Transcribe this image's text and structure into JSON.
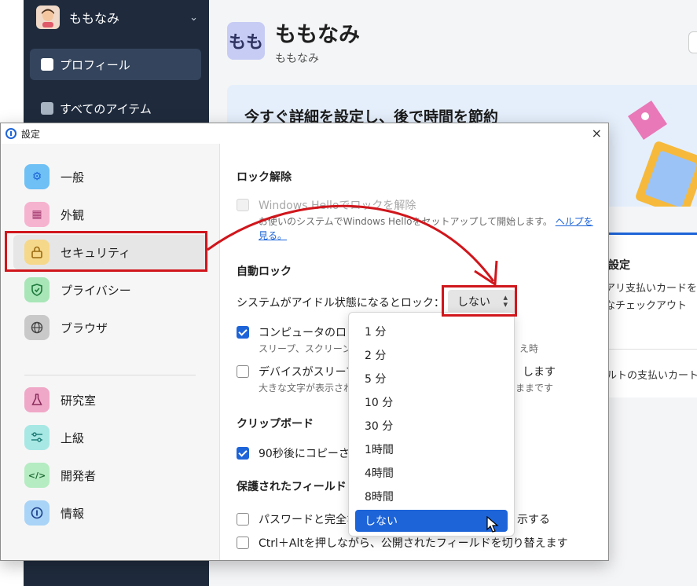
{
  "background": {
    "account_name": "ももなみ",
    "nav": [
      "プロフィール",
      "すべてのアイテム"
    ],
    "vault_icon_text": "もも",
    "vault_title": "ももなみ",
    "vault_subtitle": "ももなみ",
    "card_title": "今すぐ詳細を設定し、後で時間を節約",
    "card2_title": "設定",
    "card2_lines": [
      "アリ支払いカードを",
      "なチェックアウト",
      "。"
    ],
    "card2_footer": "ルトの支払いカート"
  },
  "dialog": {
    "title": "設定",
    "close": "×",
    "categories": [
      {
        "label": "一般",
        "icon": "gear-icon",
        "color": "#6ec0f5",
        "glyph": "⚙",
        "selected": false
      },
      {
        "label": "外観",
        "icon": "palette-icon",
        "color": "#f6b3d0",
        "glyph": "▦",
        "selected": false
      },
      {
        "label": "セキュリティ",
        "icon": "lock-icon",
        "color": "#f6d88a",
        "glyph": "🔒",
        "selected": true
      },
      {
        "label": "プライバシー",
        "icon": "shield-icon",
        "color": "#a8e6b8",
        "glyph": "✓",
        "selected": false
      },
      {
        "label": "ブラウザ",
        "icon": "globe-icon",
        "color": "#c9c9c9",
        "glyph": "◍",
        "selected": false
      },
      {
        "label": "研究室",
        "icon": "flask-icon",
        "color": "#f0a8c8",
        "glyph": "⚗",
        "selected": false
      },
      {
        "label": "上級",
        "icon": "sliders-icon",
        "color": "#a8e8e4",
        "glyph": "≡",
        "selected": false
      },
      {
        "label": "開発者",
        "icon": "code-icon",
        "color": "#b6ecc2",
        "glyph": "</>",
        "selected": false
      },
      {
        "label": "情報",
        "icon": "info-icon",
        "color": "#a9d4f7",
        "glyph": "ⓘ",
        "selected": false
      }
    ],
    "unlock": {
      "heading": "ロック解除",
      "windows_hello_label": "Windows Helloでロックを解除",
      "windows_hello_sub1": "お使いのシステムでWindows Helloをセットアップして開始します。",
      "help_link_1": "ヘルプを",
      "help_link_2": "見る。"
    },
    "autolock": {
      "heading": "自動ロック",
      "idle_label": "システムがアイドル状態になるとロック：",
      "idle_value": "しない",
      "lock_on_computer_label": "コンピュータのロッ",
      "lock_on_computer_sub": "スリープ、スクリーン",
      "lock_on_computer_sub_tail": "え時",
      "sleep_label": "デバイスがスリープ",
      "sleep_label_tail": "します",
      "sleep_sub": "大きな文字が表示され",
      "sleep_sub_tail": "ままです",
      "lock_on_computer_checked": true,
      "sleep_checked": false
    },
    "clipboard": {
      "heading": "クリップボード",
      "clear_label": "90秒後にコピーさ",
      "clear_checked": true
    },
    "protected": {
      "heading": "保護されたフィールド",
      "password_label": "パスワードと完全な",
      "password_label_tail": "示する",
      "toggle_label": "Ctrl＋Altを押しながら、公開されたフィールドを切り替えます"
    },
    "dropdown_options": [
      "1 分",
      "2 分",
      "5 分",
      "10 分",
      "30 分",
      "1時間",
      "4時間",
      "8時間",
      "しない"
    ],
    "dropdown_selected": "しない"
  },
  "colors": {
    "accent": "#1d64d8",
    "annotation": "#d0161c",
    "sidebar_bg": "#1f2b3d"
  }
}
